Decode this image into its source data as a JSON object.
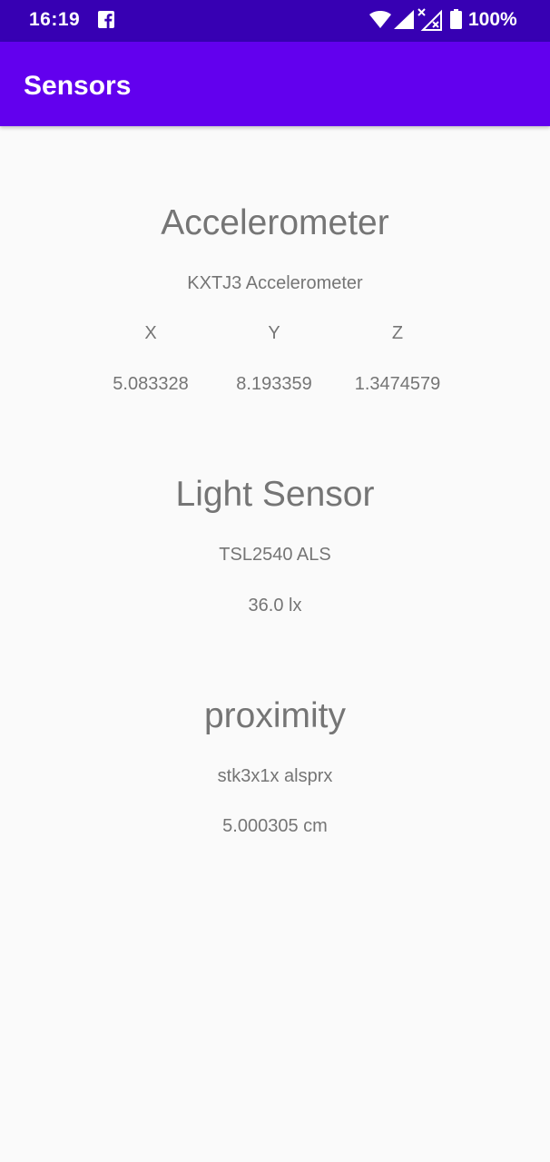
{
  "status_bar": {
    "time": "16:19",
    "battery": "100%",
    "icons": [
      "facebook-icon",
      "wifi-icon",
      "cell-signal-icon",
      "no-signal-icon",
      "battery-icon"
    ]
  },
  "app_bar": {
    "title": "Sensors",
    "color": "#6200ee",
    "status_color": "#3700b3"
  },
  "accelerometer": {
    "heading": "Accelerometer",
    "sensor_name": "KXTJ3 Accelerometer",
    "axes": [
      {
        "label": "X",
        "value": "5.083328"
      },
      {
        "label": "Y",
        "value": "8.193359"
      },
      {
        "label": "Z",
        "value": "1.3474579"
      }
    ]
  },
  "light": {
    "heading": "Light Sensor",
    "sensor_name": "TSL2540 ALS",
    "value": "36.0 lx"
  },
  "proximity": {
    "heading": "proximity",
    "sensor_name": "stk3x1x alsprx",
    "value": "5.000305 cm"
  }
}
